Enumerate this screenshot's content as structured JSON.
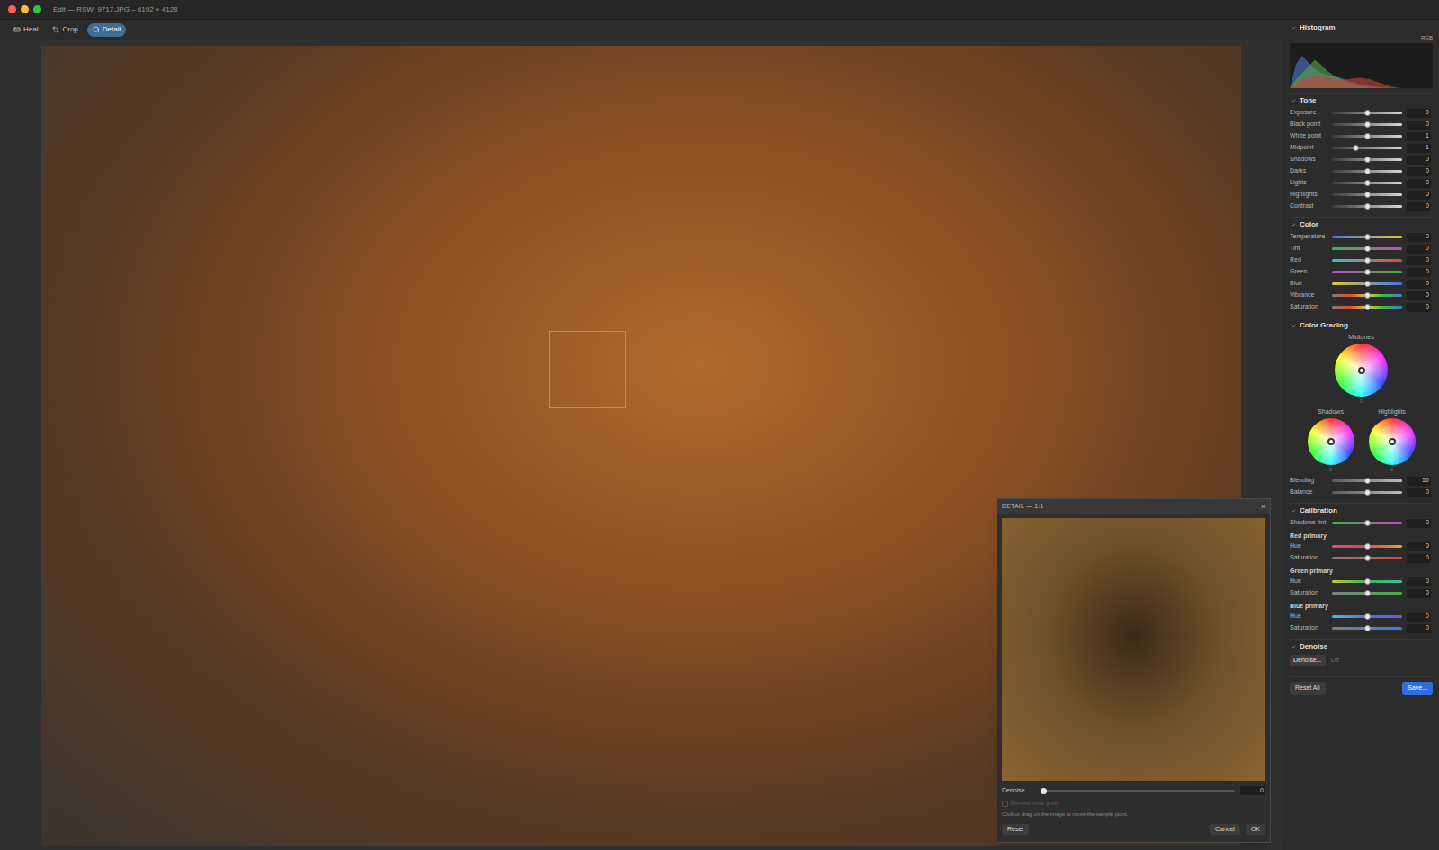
{
  "window": {
    "title": "Edit — RSW_9717.JPG – 6192 × 4128",
    "controls": [
      {
        "name": "close",
        "color": "#ff5f57"
      },
      {
        "name": "minimize",
        "color": "#febc2e"
      },
      {
        "name": "zoom",
        "color": "#28c840"
      }
    ]
  },
  "tools": [
    {
      "label": "Heal",
      "icon": "heal",
      "selected": false
    },
    {
      "label": "Crop",
      "icon": "crop",
      "selected": false
    },
    {
      "label": "Detail",
      "icon": "detail",
      "selected": true
    }
  ],
  "detail": {
    "title": "DETAIL — 1:1",
    "close": "×",
    "slider": {
      "label": "Denoise",
      "level": 0,
      "reading": "0"
    },
    "option": {
      "label": "Preview noise grain",
      "checked": false,
      "disabled": true
    },
    "hint": "Click or drag on the image to move the sample point.",
    "buttons": [
      {
        "label": "Reset",
        "primary": false
      },
      {
        "label": "Cancel",
        "primary": false
      },
      {
        "label": "OK",
        "primary": false
      }
    ]
  },
  "histogram": {
    "title": "Histogram",
    "expanded": true,
    "channel": "RGB",
    "series": [
      {
        "name": "blue",
        "color": "#4a78d0",
        "values": [
          0,
          0.55,
          0.75,
          0.6,
          0.45,
          0.35,
          0.3,
          0.28,
          0.25,
          0.2,
          0.15,
          0.1,
          0.07,
          0.05,
          0.03,
          0.02,
          0.01,
          0,
          0,
          0,
          0,
          0,
          0,
          0
        ]
      },
      {
        "name": "green",
        "color": "#5aa84a",
        "values": [
          0,
          0.2,
          0.35,
          0.5,
          0.65,
          0.55,
          0.4,
          0.3,
          0.22,
          0.15,
          0.1,
          0.06,
          0.04,
          0.02,
          0.01,
          0,
          0,
          0,
          0,
          0,
          0,
          0,
          0,
          0
        ]
      },
      {
        "name": "red",
        "color": "#c8443a",
        "values": [
          0,
          0.1,
          0.2,
          0.25,
          0.3,
          0.28,
          0.25,
          0.22,
          0.2,
          0.2,
          0.22,
          0.24,
          0.23,
          0.2,
          0.15,
          0.1,
          0.05,
          0.02,
          0,
          0,
          0,
          0,
          0,
          0
        ]
      }
    ]
  },
  "sections": [
    {
      "title": "Tone",
      "expanded": true,
      "rows": [
        {
          "kind": "slider",
          "label": "Exposure",
          "level": 0.5,
          "reading": "0",
          "track": [
            "#3a3a3a",
            "#d8d8d8"
          ]
        },
        {
          "kind": "slider",
          "label": "Black point",
          "level": 0.5,
          "reading": "0",
          "track": [
            "#3a3a3a",
            "#d8d8d8"
          ]
        },
        {
          "kind": "slider",
          "label": "White point",
          "level": 0.5,
          "reading": "1",
          "track": [
            "#3a3a3a",
            "#d8d8d8"
          ]
        },
        {
          "kind": "slider",
          "label": "Midpoint",
          "level": 0.34,
          "reading": "1",
          "track": [
            "#3a3a3a",
            "#d8d8d8"
          ]
        },
        {
          "kind": "slider",
          "label": "Shadows",
          "level": 0.5,
          "reading": "0",
          "track": [
            "#3a3a3a",
            "#d8d8d8"
          ]
        },
        {
          "kind": "slider",
          "label": "Darks",
          "level": 0.5,
          "reading": "0",
          "track": [
            "#3a3a3a",
            "#d8d8d8"
          ]
        },
        {
          "kind": "slider",
          "label": "Lights",
          "level": 0.5,
          "reading": "0",
          "track": [
            "#3a3a3a",
            "#d8d8d8"
          ]
        },
        {
          "kind": "slider",
          "label": "Highlights",
          "level": 0.5,
          "reading": "0",
          "track": [
            "#3a3a3a",
            "#d8d8d8"
          ]
        },
        {
          "kind": "slider",
          "label": "Contrast",
          "level": 0.5,
          "reading": "0",
          "track": [
            "#3a3a3a",
            "#d8d8d8"
          ]
        }
      ]
    },
    {
      "title": "Color",
      "expanded": true,
      "rows": [
        {
          "kind": "slider",
          "label": "Temperature",
          "level": 0.5,
          "reading": "0",
          "track": [
            "#3d7be0",
            "#e6c43c"
          ]
        },
        {
          "kind": "slider",
          "label": "Tint",
          "level": 0.5,
          "reading": "0",
          "track": [
            "#3cb44a",
            "#c648c0"
          ]
        },
        {
          "kind": "slider",
          "label": "Red",
          "level": 0.5,
          "reading": "0",
          "track": [
            "#3fc0c8",
            "#e04a3a"
          ]
        },
        {
          "kind": "slider",
          "label": "Green",
          "level": 0.5,
          "reading": "0",
          "track": [
            "#c648c0",
            "#3cb44a"
          ]
        },
        {
          "kind": "slider",
          "label": "Blue",
          "level": 0.5,
          "reading": "0",
          "track": [
            "#e6c43c",
            "#3d7be0"
          ]
        },
        {
          "kind": "slider",
          "label": "Vibrance",
          "level": 0.5,
          "reading": "0",
          "track": [
            "#808080",
            "#e04a3a",
            "#e6c43c",
            "#3cb44a",
            "#3d7be0"
          ]
        },
        {
          "kind": "slider",
          "label": "Saturation",
          "level": 0.5,
          "reading": "0",
          "track": [
            "#808080",
            "#e04a3a",
            "#e6c43c",
            "#3cb44a",
            "#3d7be0"
          ]
        }
      ]
    },
    {
      "title": "Color Grading",
      "expanded": true,
      "rows": [
        {
          "kind": "wheels",
          "size": "large",
          "wheels": [
            {
              "label": "Midtones",
              "reading": "0",
              "x": 0.5,
              "y": 0.5
            }
          ]
        },
        {
          "kind": "wheels",
          "size": "small",
          "wheels": [
            {
              "label": "Shadows",
              "reading": "0",
              "x": 0.5,
              "y": 0.5
            },
            {
              "label": "Highlights",
              "reading": "0",
              "x": 0.5,
              "y": 0.5
            }
          ]
        },
        {
          "kind": "slider",
          "label": "Blending",
          "level": 0.5,
          "reading": "50",
          "track": [
            "#5a5a5a",
            "#bdbdbd"
          ]
        },
        {
          "kind": "slider",
          "label": "Balance",
          "level": 0.5,
          "reading": "0",
          "track": [
            "#5a5a5a",
            "#bdbdbd"
          ]
        }
      ]
    },
    {
      "title": "Calibration",
      "expanded": true,
      "rows": [
        {
          "kind": "slider",
          "label": "Shadows tint",
          "level": 0.5,
          "reading": "0",
          "track": [
            "#3cb44a",
            "#c648c0"
          ]
        },
        {
          "kind": "heading",
          "label": "Red primary"
        },
        {
          "kind": "slider",
          "label": "Hue",
          "level": 0.5,
          "reading": "0",
          "track": [
            "#e04a8a",
            "#e04a3a",
            "#e6a43c"
          ]
        },
        {
          "kind": "slider",
          "label": "Saturation",
          "level": 0.5,
          "reading": "0",
          "track": [
            "#808080",
            "#e04a3a"
          ]
        },
        {
          "kind": "heading",
          "label": "Green primary"
        },
        {
          "kind": "slider",
          "label": "Hue",
          "level": 0.5,
          "reading": "0",
          "track": [
            "#c6c43c",
            "#3cb44a",
            "#3cc0a0"
          ]
        },
        {
          "kind": "slider",
          "label": "Saturation",
          "level": 0.5,
          "reading": "0",
          "track": [
            "#808080",
            "#3cb44a"
          ]
        },
        {
          "kind": "heading",
          "label": "Blue primary"
        },
        {
          "kind": "slider",
          "label": "Hue",
          "level": 0.5,
          "reading": "0",
          "track": [
            "#3cc0e0",
            "#3d7be0",
            "#8a48e0"
          ]
        },
        {
          "kind": "slider",
          "label": "Saturation",
          "level": 0.5,
          "reading": "0",
          "track": [
            "#808080",
            "#3d7be0"
          ]
        }
      ]
    },
    {
      "title": "Denoise",
      "expanded": true,
      "rows": [
        {
          "kind": "button",
          "label": "Denoise...",
          "reading": "Off"
        }
      ]
    }
  ],
  "footer": [
    {
      "label": "Reset All",
      "primary": false
    },
    {
      "label": "Save...",
      "primary": true
    }
  ]
}
